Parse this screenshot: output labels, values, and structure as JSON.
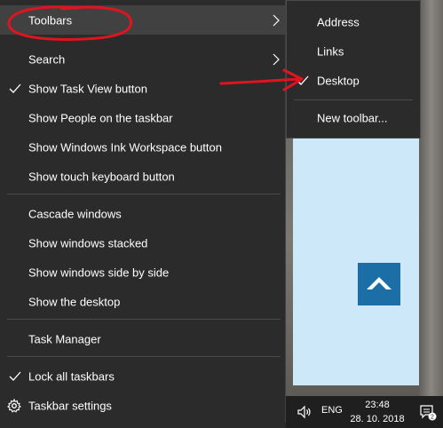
{
  "context_menu": {
    "toolbars": "Toolbars",
    "search": "Search",
    "show_task_view": "Show Task View button",
    "show_people": "Show People on the taskbar",
    "show_windows_ink": "Show Windows Ink Workspace button",
    "show_touch_keyboard": "Show touch keyboard button",
    "cascade": "Cascade windows",
    "stacked": "Show windows stacked",
    "side_by_side": "Show windows side by side",
    "show_desktop": "Show the desktop",
    "task_manager": "Task Manager",
    "lock_taskbars": "Lock all taskbars",
    "taskbar_settings": "Taskbar settings"
  },
  "toolbars_submenu": {
    "address": "Address",
    "links": "Links",
    "desktop": "Desktop",
    "new_toolbar": "New toolbar..."
  },
  "taskbar": {
    "language": "ENG",
    "time": "23:48",
    "date": "28. 10. 2018",
    "notification_count": "2"
  },
  "colors": {
    "menu_bg": "#2b2b2b",
    "highlight": "#414141",
    "annotation_red": "#e0141e",
    "app_tile": "#1c6ea7",
    "window_bg": "#cce8f9"
  }
}
